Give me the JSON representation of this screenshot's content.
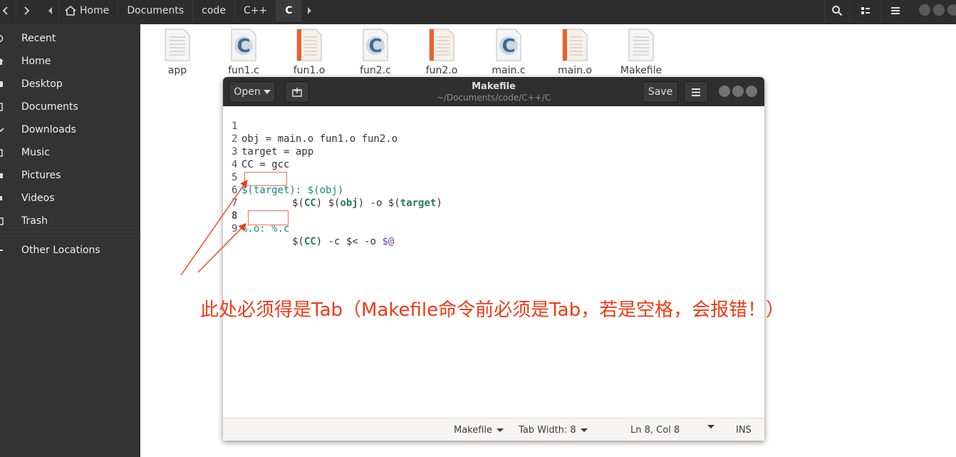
{
  "nautilus": {
    "breadcrumbs": [
      "Home",
      "Documents",
      "code",
      "C++",
      "C"
    ],
    "sidebar": [
      {
        "label": "Recent",
        "icon": "clock-icon"
      },
      {
        "label": "Home",
        "icon": "home-icon"
      },
      {
        "label": "Desktop",
        "icon": "desktop-icon"
      },
      {
        "label": "Documents",
        "icon": "documents-icon"
      },
      {
        "label": "Downloads",
        "icon": "downloads-icon"
      },
      {
        "label": "Music",
        "icon": "music-icon"
      },
      {
        "label": "Pictures",
        "icon": "pictures-icon"
      },
      {
        "label": "Videos",
        "icon": "videos-icon"
      },
      {
        "label": "Trash",
        "icon": "trash-icon"
      },
      {
        "label": "Other Locations",
        "icon": "other-locations-icon"
      }
    ],
    "files": [
      {
        "name": "app",
        "type": "binary"
      },
      {
        "name": "fun1.c",
        "type": "c-source"
      },
      {
        "name": "fun1.o",
        "type": "object"
      },
      {
        "name": "fun2.c",
        "type": "c-source"
      },
      {
        "name": "fun2.o",
        "type": "object"
      },
      {
        "name": "main.c",
        "type": "c-source"
      },
      {
        "name": "main.o",
        "type": "object"
      },
      {
        "name": "Makefile",
        "type": "text"
      }
    ]
  },
  "gedit": {
    "open_label": "Open",
    "save_label": "Save",
    "title": "Makefile",
    "subtitle": "~/Documents/code/C++/C",
    "lines": [
      {
        "n": "1",
        "text": "obj = main.o fun1.o fun2.o"
      },
      {
        "n": "2",
        "text": "target = app"
      },
      {
        "n": "3",
        "text": "CC = gcc"
      },
      {
        "n": "4",
        "text": ""
      },
      {
        "n": "5",
        "text": "$(target): $(obj)"
      },
      {
        "n": "6",
        "text": "$(CC) $(obj) -o $(target)"
      },
      {
        "n": "7",
        "text": ""
      },
      {
        "n": "8",
        "text": "%.o: %.c"
      },
      {
        "n": "9",
        "text": "$(CC) -c $< -o $@"
      }
    ],
    "status": {
      "language": "Makefile",
      "tab_width": "Tab Width: 8",
      "position": "Ln 8, Col 8",
      "mode": "INS"
    }
  },
  "annotation": {
    "text": "此处必须得是Tab（Makefile命令前必须是Tab，若是空格，会报错！）",
    "color": "#ee3a16"
  }
}
